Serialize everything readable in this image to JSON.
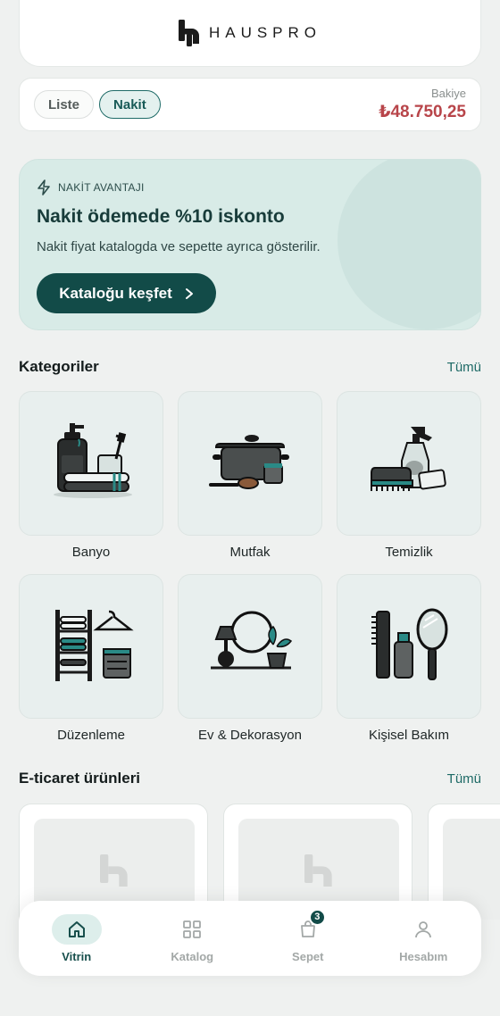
{
  "brand": {
    "name": "HAUSPRO"
  },
  "modes": {
    "liste": "Liste",
    "nakit": "Nakit",
    "active": "Nakit"
  },
  "balance": {
    "label": "Bakiye",
    "value": "₺48.750,25"
  },
  "promo": {
    "tag": "NAKİT AVANTAJI",
    "title": "Nakit ödemede %10 iskonto",
    "subtitle": "Nakit fiyat katalogda ve sepette ayrıca gösterilir.",
    "button": "Kataloğu keşfet"
  },
  "categories": {
    "title": "Kategoriler",
    "link": "Tümü",
    "items": [
      {
        "label": "Banyo",
        "icon": "bathroom-icon"
      },
      {
        "label": "Mutfak",
        "icon": "kitchen-pot-icon"
      },
      {
        "label": "Temizlik",
        "icon": "cleaning-icon"
      },
      {
        "label": "Düzenleme",
        "icon": "organizer-shelf-icon"
      },
      {
        "label": "Ev & Dekorasyon",
        "icon": "home-decor-icon"
      },
      {
        "label": "Kişisel Bakım",
        "icon": "personal-care-icon"
      }
    ]
  },
  "products": {
    "title": "E-ticaret ürünleri",
    "link": "Tümü"
  },
  "nav": {
    "items": [
      {
        "label": "Vitrin",
        "icon": "home-icon",
        "active": true
      },
      {
        "label": "Katalog",
        "icon": "grid-icon",
        "active": false
      },
      {
        "label": "Sepet",
        "icon": "cart-icon",
        "active": false,
        "badge": "3"
      },
      {
        "label": "Hesabım",
        "icon": "user-icon",
        "active": false
      }
    ]
  },
  "colors": {
    "accent": "#124b48",
    "balance": "#b8454a",
    "promo_bg": "#d8ebe7",
    "page_bg": "#eff1f0"
  }
}
